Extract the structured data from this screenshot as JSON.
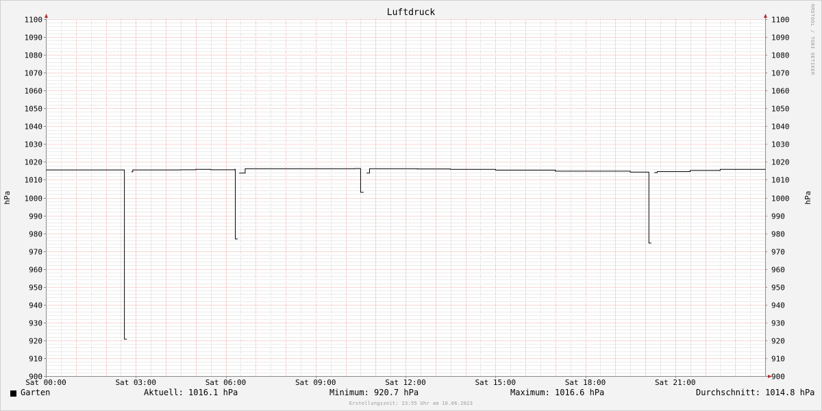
{
  "chart_data": {
    "type": "line",
    "title": "Luftdruck",
    "ylabel": "hPa",
    "ylabel_right": "hPa",
    "ylim": [
      900,
      1100
    ],
    "yticks": [
      900,
      910,
      920,
      930,
      940,
      950,
      960,
      970,
      980,
      990,
      1000,
      1010,
      1020,
      1030,
      1040,
      1050,
      1060,
      1070,
      1080,
      1090,
      1100
    ],
    "xlim_hours": [
      0,
      24
    ],
    "xticks": [
      {
        "h": 0,
        "label": "Sat 00:00"
      },
      {
        "h": 3,
        "label": "Sat 03:00"
      },
      {
        "h": 6,
        "label": "Sat 06:00"
      },
      {
        "h": 9,
        "label": "Sat 09:00"
      },
      {
        "h": 12,
        "label": "Sat 12:00"
      },
      {
        "h": 15,
        "label": "Sat 15:00"
      },
      {
        "h": 18,
        "label": "Sat 18:00"
      },
      {
        "h": 21,
        "label": "Sat 21:00"
      }
    ],
    "grid": true,
    "series": [
      {
        "name": "Garten",
        "color": "#000000",
        "segments": [
          [
            [
              0,
              1015.5
            ],
            [
              2.6,
              1015.5
            ],
            [
              2.62,
              920.7
            ],
            [
              2.7,
              920.7
            ]
          ],
          [
            [
              2.85,
              1014.5
            ],
            [
              2.9,
              1015.5
            ],
            [
              4.5,
              1015.6
            ],
            [
              5.0,
              1015.8
            ],
            [
              5.5,
              1015.6
            ],
            [
              6.3,
              1015.8
            ],
            [
              6.32,
              976.8
            ],
            [
              6.4,
              976.8
            ]
          ],
          [
            [
              6.45,
              1013.8
            ],
            [
              6.55,
              1013.8
            ],
            [
              6.65,
              1016.2
            ],
            [
              9.5,
              1016.2
            ],
            [
              10.3,
              1016.3
            ],
            [
              10.45,
              1016.3
            ],
            [
              10.5,
              1003.0
            ],
            [
              10.6,
              1003.0
            ]
          ],
          [
            [
              10.7,
              1013.8
            ],
            [
              10.8,
              1016.2
            ],
            [
              12.4,
              1016.1
            ],
            [
              13.5,
              1015.8
            ],
            [
              15.0,
              1015.4
            ],
            [
              17.0,
              1014.8
            ],
            [
              19.5,
              1014.3
            ],
            [
              20.1,
              1014.3
            ],
            [
              20.12,
              974.5
            ],
            [
              20.2,
              974.5
            ]
          ],
          [
            [
              20.3,
              1014.0
            ],
            [
              20.4,
              1014.6
            ],
            [
              21.5,
              1015.2
            ],
            [
              22.5,
              1015.8
            ],
            [
              24,
              1016.1
            ]
          ]
        ]
      }
    ]
  },
  "legend": {
    "series_name": "Garten",
    "current": "Aktuell: 1016.1 hPa",
    "minimum": "Minimum: 920.7 hPa",
    "maximum": "Maximum: 1016.6 hPa",
    "average": "Durchschnitt: 1014.8 hPa"
  },
  "footer": "Erstellungszeit: 23:55 Uhr am 10.06.2023",
  "credit": "RRDTOOL / TOBI OETIKER"
}
